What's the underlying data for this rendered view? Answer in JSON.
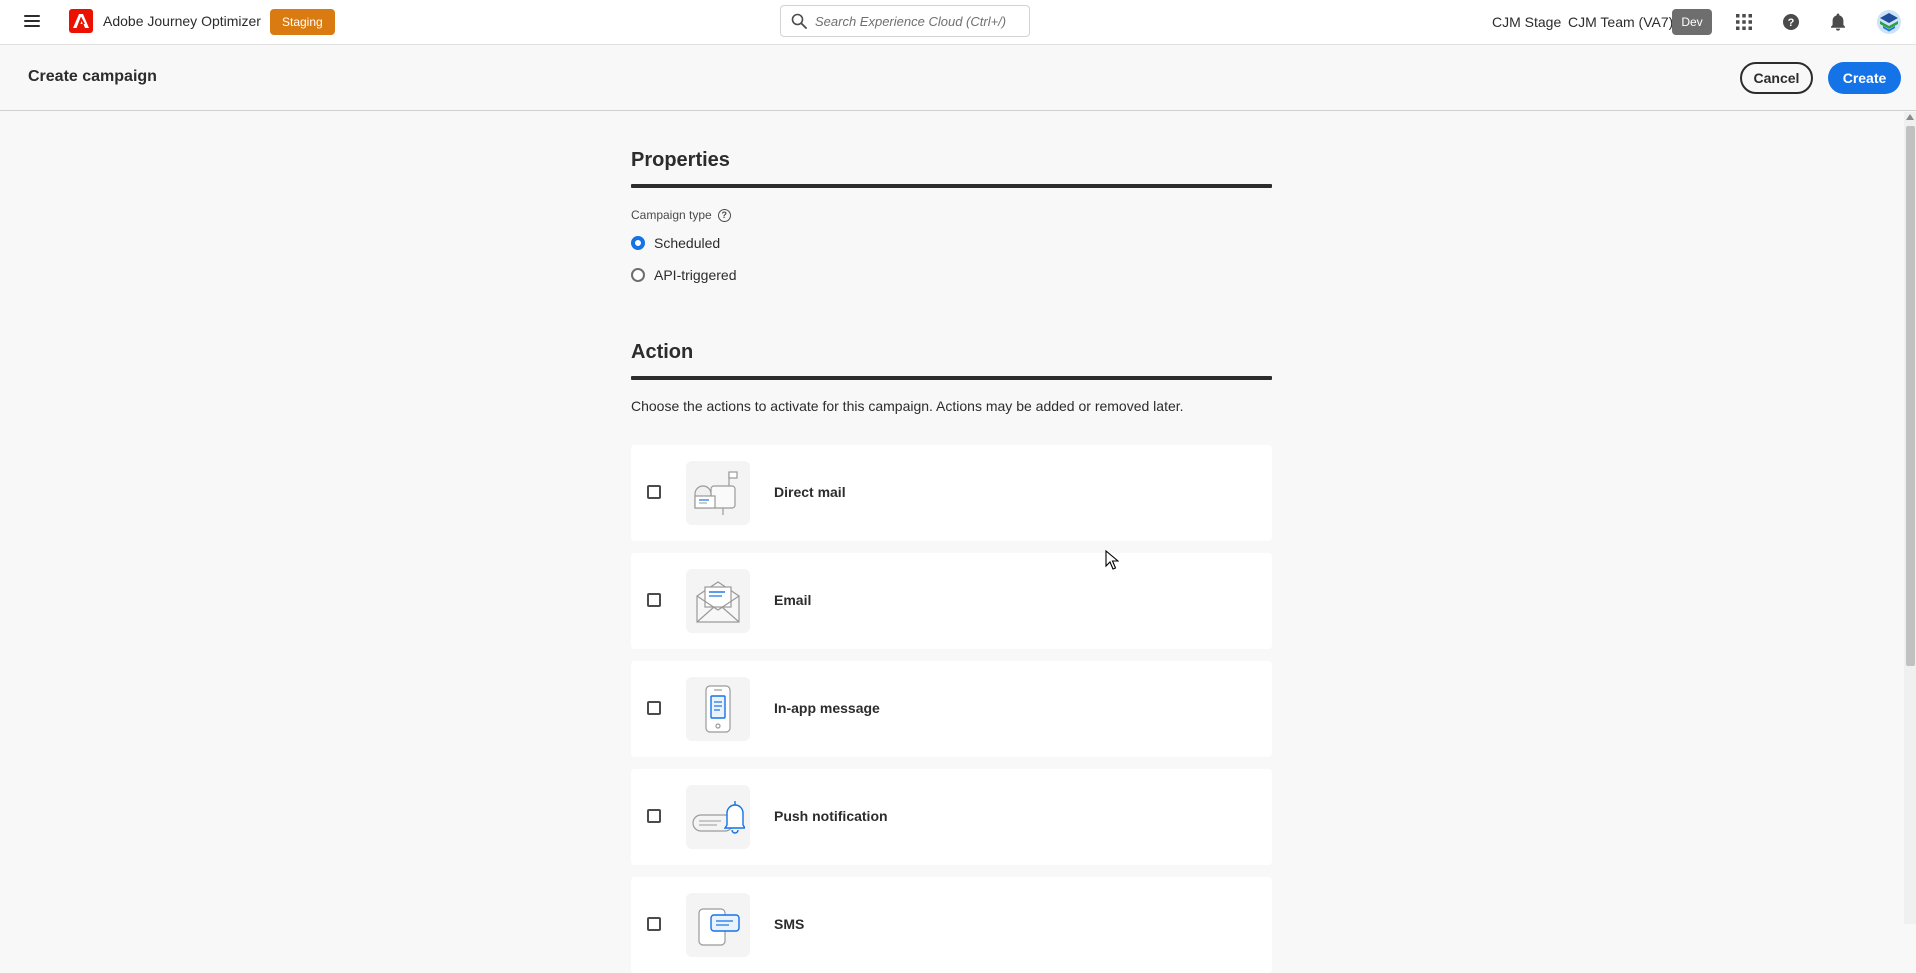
{
  "shell": {
    "app_name": "Adobe Journey Optimizer",
    "env_badge": "Staging",
    "search_placeholder": "Search Experience Cloud (Ctrl+/)",
    "org_name": "CJM Stage",
    "team_name": "CJM Team (VA7)",
    "sandbox_badge": "Dev",
    "colors": {
      "brand": "#eb1000",
      "staging": "#da7b11",
      "accent": "#1473e6"
    }
  },
  "header": {
    "title": "Create campaign",
    "cancel_label": "Cancel",
    "create_label": "Create"
  },
  "properties": {
    "title": "Properties",
    "campaign_type_label": "Campaign type",
    "options": [
      {
        "label": "Scheduled",
        "selected": true
      },
      {
        "label": "API-triggered",
        "selected": false
      }
    ]
  },
  "action": {
    "title": "Action",
    "description": "Choose the actions to activate for this campaign. Actions may be added or removed later.",
    "items": [
      {
        "label": "Direct mail",
        "icon": "mailbox-icon",
        "checked": false
      },
      {
        "label": "Email",
        "icon": "envelope-icon",
        "checked": false
      },
      {
        "label": "In-app message",
        "icon": "phone-icon",
        "checked": false
      },
      {
        "label": "Push notification",
        "icon": "bell-icon",
        "checked": false
      },
      {
        "label": "SMS",
        "icon": "sms-icon",
        "checked": false
      }
    ]
  }
}
